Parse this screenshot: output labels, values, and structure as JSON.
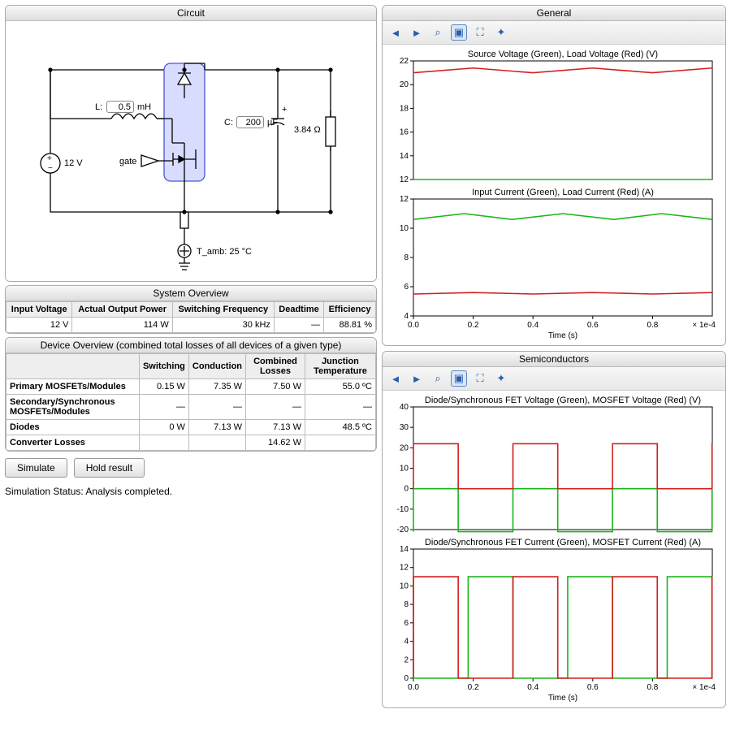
{
  "circuit": {
    "title": "Circuit",
    "L_value": "0.5",
    "L_unit": "mH",
    "L_prefix": "L:",
    "C_prefix": "C:",
    "C_value": "200",
    "C_unit": "µF",
    "R_label": "3.84 Ω",
    "Vin_label": "12 V",
    "gate_label": "gate",
    "Tamb_label": "T_amb: 25 °C"
  },
  "system_overview": {
    "title": "System Overview",
    "headers": [
      "Input Voltage",
      "Actual Output Power",
      "Switching Frequency",
      "Deadtime",
      "Efficiency"
    ],
    "row": [
      "12 V",
      "114 W",
      "30 kHz",
      "—",
      "88.81 %"
    ]
  },
  "device_overview": {
    "title": "Device Overview (combined total losses of all devices of a given type)",
    "headers": [
      "",
      "Switching",
      "Conduction",
      "Combined Losses",
      "Junction Temperature"
    ],
    "rows": [
      [
        "Primary MOSFETs/Modules",
        "0.15 W",
        "7.35 W",
        "7.50 W",
        "55.0 ºC"
      ],
      [
        "Secondary/Synchronous MOSFETs/Modules",
        "—",
        "—",
        "—",
        "—"
      ],
      [
        "Diodes",
        "0 W",
        "7.13 W",
        "7.13 W",
        "48.5 ºC"
      ],
      [
        "Converter Losses",
        "",
        "",
        "14.62 W",
        ""
      ]
    ]
  },
  "buttons": {
    "simulate": "Simulate",
    "hold": "Hold result"
  },
  "status_label": "Simulation Status: Analysis completed.",
  "general": {
    "title": "General",
    "chart1_title": "Source Voltage (Green),  Load Voltage (Red) (V)",
    "chart2_title": "Input Current (Green),  Load Current (Red) (A)",
    "xlabel": "Time (s)",
    "xmax_label": "× 1e-4"
  },
  "semiconductors": {
    "title": "Semiconductors",
    "chart1_title": "Diode/Synchronous FET Voltage (Green),  MOSFET Voltage (Red) (V)",
    "chart2_title": "Diode/Synchronous FET Current (Green),  MOSFET Current (Red) (A)",
    "xlabel": "Time (s)",
    "xmax_label": "× 1e-4"
  },
  "chart_data": [
    {
      "id": "general_voltage",
      "type": "line",
      "title": "Source Voltage (Green),  Load Voltage (Red) (V)",
      "xlabel": "Time (s)",
      "xlim": [
        0,
        0.0001
      ],
      "ylim": [
        12,
        22
      ],
      "yticks": [
        12,
        14,
        16,
        18,
        20,
        22
      ],
      "xticks": [
        0.0,
        0.2,
        0.4,
        0.6,
        0.8
      ],
      "series": [
        {
          "name": "Source Voltage",
          "color": "#1ab51a",
          "x": [
            0,
            0.0001
          ],
          "y": [
            12,
            12
          ],
          "flat": true
        },
        {
          "name": "Load Voltage",
          "color": "#d21f1f",
          "x": [
            0,
            2e-05,
            4e-05,
            6e-05,
            8e-05,
            0.0001
          ],
          "y": [
            21.0,
            21.4,
            21.0,
            21.4,
            21.0,
            21.4
          ]
        }
      ]
    },
    {
      "id": "general_current",
      "type": "line",
      "title": "Input Current (Green),  Load Current (Red) (A)",
      "xlabel": "Time (s)",
      "xlim": [
        0,
        0.0001
      ],
      "ylim": [
        4,
        12
      ],
      "yticks": [
        4,
        6,
        8,
        10,
        12
      ],
      "xticks": [
        0.0,
        0.2,
        0.4,
        0.6,
        0.8
      ],
      "series": [
        {
          "name": "Input Current",
          "color": "#1ab51a",
          "x": [
            0,
            1.7e-05,
            3.3e-05,
            5e-05,
            6.7e-05,
            8.3e-05,
            0.0001
          ],
          "y": [
            10.6,
            11.0,
            10.6,
            11.0,
            10.6,
            11.0,
            10.6
          ]
        },
        {
          "name": "Load Current",
          "color": "#d21f1f",
          "x": [
            0,
            2e-05,
            4e-05,
            6e-05,
            8e-05,
            0.0001
          ],
          "y": [
            5.5,
            5.6,
            5.5,
            5.6,
            5.5,
            5.6
          ]
        }
      ]
    },
    {
      "id": "semi_voltage",
      "type": "line",
      "title": "Diode/Synchronous FET Voltage (Green),  MOSFET Voltage (Red) (V)",
      "xlabel": "Time (s)",
      "xlim": [
        0,
        0.0001
      ],
      "ylim": [
        -20,
        40
      ],
      "yticks": [
        -20,
        -10,
        0,
        10,
        20,
        30,
        40
      ],
      "xticks": [
        0.0,
        0.2,
        0.4,
        0.6,
        0.8
      ],
      "series": [
        {
          "name": "Diode/Sync FET Voltage",
          "color": "#1ab51a",
          "square": true,
          "period": 3.33e-05,
          "duty": 0.45,
          "lo": -21,
          "hi": 0
        },
        {
          "name": "MOSFET Voltage",
          "color": "#d21f1f",
          "square": true,
          "period": 3.33e-05,
          "duty": 0.45,
          "lo": 0,
          "hi": 22
        }
      ]
    },
    {
      "id": "semi_current",
      "type": "line",
      "title": "Diode/Synchronous FET Current (Green),  MOSFET Current (Red) (A)",
      "xlabel": "Time (s)",
      "xlim": [
        0,
        0.0001
      ],
      "ylim": [
        0,
        14
      ],
      "yticks": [
        0,
        2,
        4,
        6,
        8,
        10,
        12,
        14
      ],
      "xticks": [
        0.0,
        0.2,
        0.4,
        0.6,
        0.8
      ],
      "series": [
        {
          "name": "Diode/Sync FET Current",
          "color": "#1ab51a",
          "square": true,
          "period": 3.33e-05,
          "duty": 0.55,
          "lo": 0,
          "hi": 11,
          "invert": true
        },
        {
          "name": "MOSFET Current",
          "color": "#d21f1f",
          "square": true,
          "period": 3.33e-05,
          "duty": 0.45,
          "lo": 0,
          "hi": 11
        }
      ]
    }
  ]
}
